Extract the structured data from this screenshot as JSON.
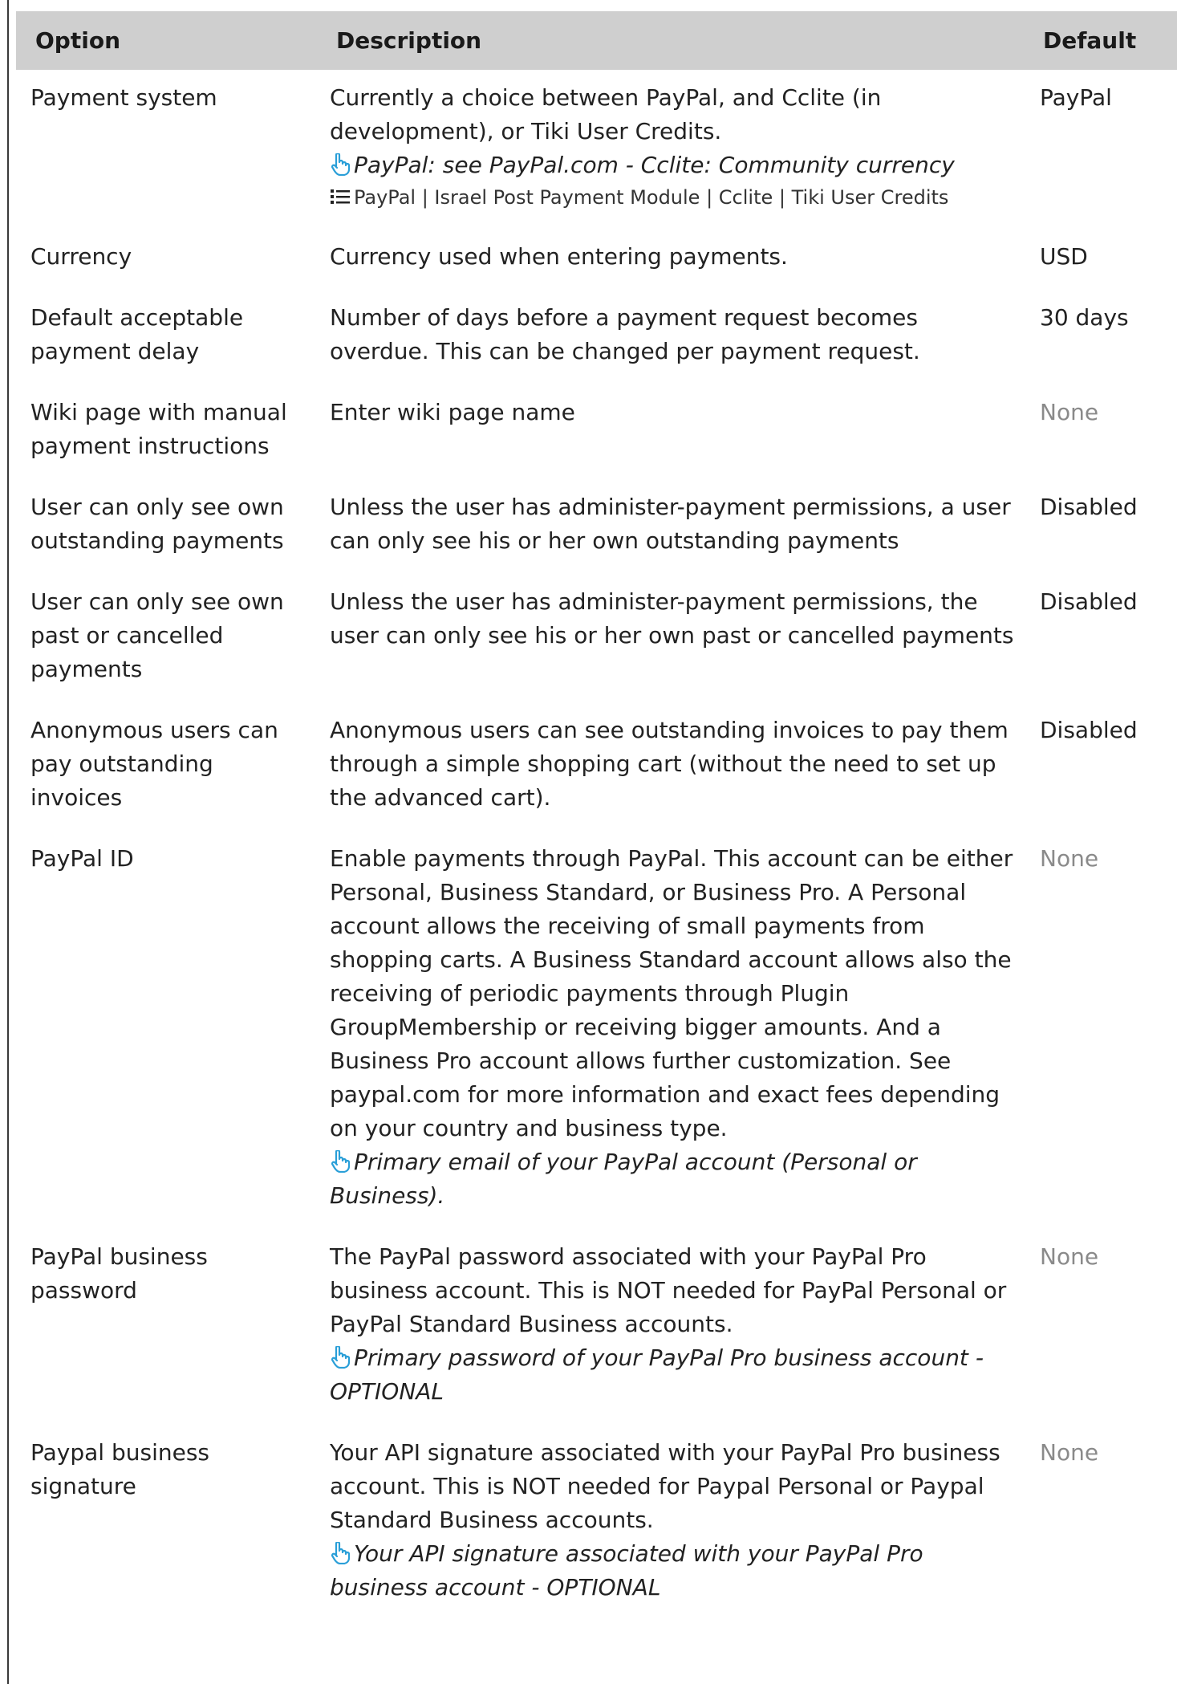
{
  "colors": {
    "header_bg": "#cfcfcf",
    "hint_icon": "#2a9fd8",
    "muted_default": "#8a8a8a"
  },
  "table": {
    "headers": {
      "option": "Option",
      "description": "Description",
      "default": "Default"
    },
    "rows": [
      {
        "option": "Payment system",
        "description": "Currently a choice between PayPal, and Cclite (in development), or Tiki User Credits.",
        "hint": "PayPal: see PayPal.com - Cclite: Community currency",
        "options_list": "PayPal | Israel Post Payment Module | Cclite | Tiki User Credits",
        "default": "PayPal",
        "default_muted": false
      },
      {
        "option": "Currency",
        "description": "Currency used when entering payments.",
        "hint": "",
        "options_list": "",
        "default": "USD",
        "default_muted": false
      },
      {
        "option": "Default acceptable payment delay",
        "description": "Number of days before a payment request becomes overdue. This can be changed per payment request.",
        "hint": "",
        "options_list": "",
        "default": "30 days",
        "default_muted": false
      },
      {
        "option": "Wiki page with manual payment instructions",
        "description": "Enter wiki page name",
        "hint": "",
        "options_list": "",
        "default": "None",
        "default_muted": true
      },
      {
        "option": "User can only see own outstanding payments",
        "description": "Unless the user has administer-payment permissions, a user can only see his or her own outstanding payments",
        "hint": "",
        "options_list": "",
        "default": "Disabled",
        "default_muted": false
      },
      {
        "option": "User can only see own past or cancelled payments",
        "description": "Unless the user has administer-payment permissions, the user can only see his or her own past or cancelled payments",
        "hint": "",
        "options_list": "",
        "default": "Disabled",
        "default_muted": false
      },
      {
        "option": "Anonymous users can pay outstanding invoices",
        "description": "Anonymous users can see outstanding invoices to pay them through a simple shopping cart (without the need to set up the advanced cart).",
        "hint": "",
        "options_list": "",
        "default": "Disabled",
        "default_muted": false
      },
      {
        "option": "PayPal ID",
        "description": "Enable payments through PayPal. This account can be either Personal, Business Standard, or Business Pro. A Personal account allows the receiving of small payments from shopping carts. A Business Standard account allows also the receiving of periodic payments through Plugin GroupMembership or receiving bigger amounts. And a Business Pro account allows further customization. See paypal.com for more information and exact fees depending on your country and business type.",
        "hint": "Primary email of your PayPal account (Personal or Business).",
        "options_list": "",
        "default": "None",
        "default_muted": true
      },
      {
        "option": "PayPal business password",
        "description": "The PayPal password associated with your PayPal Pro business account. This is NOT needed for PayPal Personal or PayPal Standard Business accounts.",
        "hint": "Primary password of your PayPal Pro business account - OPTIONAL",
        "options_list": "",
        "default": "None",
        "default_muted": true
      },
      {
        "option": "Paypal business signature",
        "description": "Your API signature associated with your PayPal Pro business account. This is NOT needed for Paypal Personal or Paypal Standard Business accounts.",
        "hint": "Your API signature associated with your PayPal Pro business account - OPTIONAL",
        "options_list": "",
        "default": "None",
        "default_muted": true
      }
    ]
  }
}
